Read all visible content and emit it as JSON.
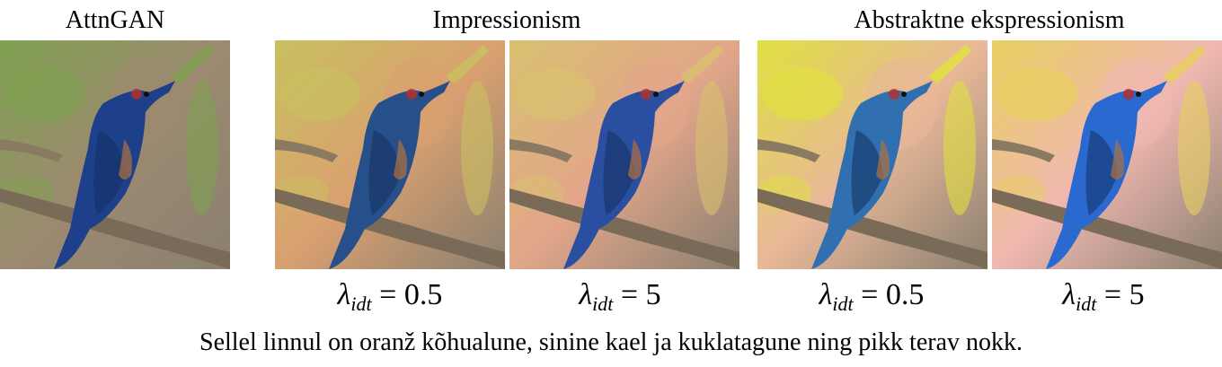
{
  "headings": {
    "attngan": "AttnGAN",
    "impressionism": "Impressionism",
    "abstract": "Abstraktne ekspressionism"
  },
  "panels": [
    {
      "palette": "original",
      "bg": "#9c8a70",
      "accent": "#7fa050",
      "bird": "#1e3f8a"
    },
    {
      "palette": "impressionism-low",
      "bg": "#d9a070",
      "accent": "#c9c060",
      "bird": "#27508a"
    },
    {
      "palette": "impressionism-high",
      "bg": "#e2a68a",
      "accent": "#d8c070",
      "bird": "#2a4fa0"
    },
    {
      "palette": "abstract-low",
      "bg": "#e8b898",
      "accent": "#e0e040",
      "bird": "#3070b0"
    },
    {
      "palette": "abstract-high",
      "bg": "#f0b8b0",
      "accent": "#e8d060",
      "bird": "#2a6ad0"
    }
  ],
  "labels": {
    "lambda_symbol": "λ",
    "lambda_sub": "idt",
    "low": "= 0.5",
    "high": "= 5"
  },
  "caption": "Sellel linnul on oranž kõhualune, sinine kael ja kuklatagune ning pikk terav nokk."
}
